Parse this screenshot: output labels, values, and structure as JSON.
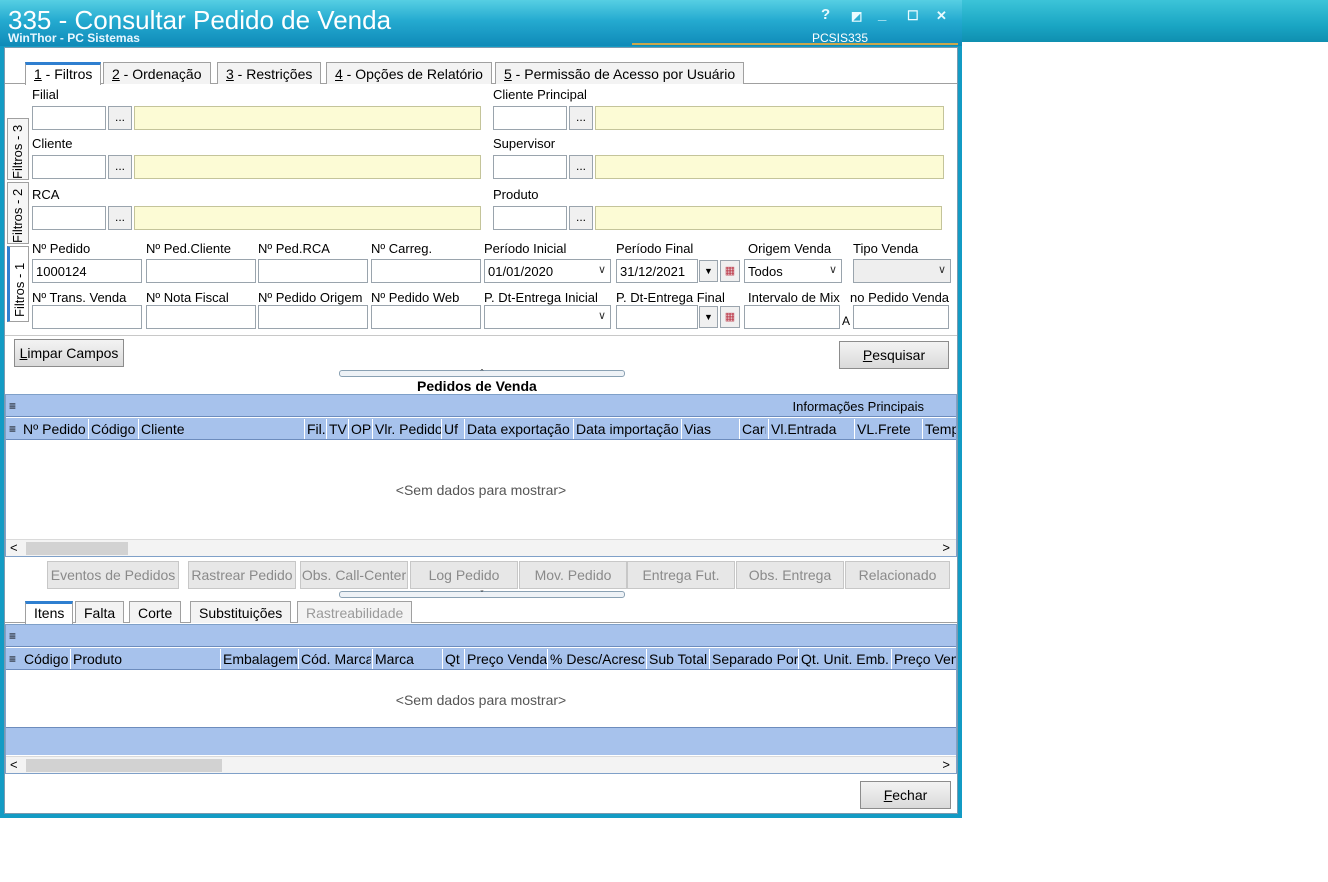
{
  "window": {
    "title": "335 - Consultar Pedido de Venda",
    "subtitle": "WinThor - PC Sistemas",
    "routine_code": "PCSIS335",
    "controls": {
      "help": "?",
      "restore_small": "◩",
      "minimize": "_",
      "maximize": "☐",
      "close": "✕"
    }
  },
  "tabs": [
    {
      "num": "1",
      "label": " - Filtros"
    },
    {
      "num": "2",
      "label": " - Ordenação"
    },
    {
      "num": "3",
      "label": " - Restrições"
    },
    {
      "num": "4",
      "label": " - Opções de Relatório"
    },
    {
      "num": "5",
      "label": " - Permissão de Acesso por Usuário"
    }
  ],
  "vertical_tabs": [
    "Filtros - 3",
    "Filtros - 2",
    "Filtros - 1"
  ],
  "filters": {
    "filial": "Filial",
    "cliente_principal": "Cliente Principal",
    "cliente": "Cliente",
    "supervisor": "Supervisor",
    "rca": "RCA",
    "produto": "Produto",
    "lookup_button": "..."
  },
  "fields_row1": {
    "num_pedido": {
      "label": "Nº Pedido",
      "value": "1000124"
    },
    "num_ped_cliente": {
      "label": "Nº Ped.Cliente",
      "value": ""
    },
    "num_ped_rca": {
      "label": "Nº Ped.RCA",
      "value": ""
    },
    "num_carreg": {
      "label": "Nº Carreg.",
      "value": ""
    },
    "periodo_inicial": {
      "label": "Período Inicial",
      "value": "01/01/2020"
    },
    "periodo_final": {
      "label": "Período Final",
      "value": "31/12/2021"
    },
    "origem_venda": {
      "label": "Origem Venda",
      "value": "Todos"
    },
    "tipo_venda": {
      "label": "Tipo Venda",
      "value": ""
    }
  },
  "fields_row2": {
    "num_trans_venda": {
      "label": "Nº Trans. Venda"
    },
    "num_nota_fiscal": {
      "label": "Nº Nota Fiscal"
    },
    "num_pedido_origem": {
      "label": "Nº Pedido Origem"
    },
    "num_pedido_web": {
      "label": "Nº Pedido Web"
    },
    "p_dt_entrega_inicial": {
      "label": "P. Dt-Entrega Inicial"
    },
    "p_dt_entrega_final": {
      "label": "P. Dt-Entrega Final"
    },
    "intervalo_mix": {
      "label": "Intervalo de Mix",
      "a": "A"
    },
    "no_pedido_venda": {
      "label": "no Pedido Venda"
    }
  },
  "buttons": {
    "limpar_campos_u": "L",
    "limpar_campos": "impar Campos",
    "pesquisar_u": "P",
    "pesquisar": "esquisar",
    "fechar_u": "F",
    "fechar": "echar"
  },
  "pedidos": {
    "title": "Pedidos de  Venda",
    "band": "Informações Principais",
    "columns": [
      "Nº Pedido",
      "Código",
      "Cliente",
      "Fil.",
      "TV",
      "OP",
      "Vlr. Pedido",
      "Uf",
      "Data exportação",
      "Data importação",
      "Vias",
      "Carı",
      "Vl.Entrada",
      "VL.Frete",
      "Temp"
    ],
    "empty": "<Sem dados para mostrar>"
  },
  "action_buttons": [
    "Eventos de Pedidos",
    "Rastrear Pedido",
    "Obs. Call-Center",
    "Log Pedido",
    "Mov. Pedido",
    "Entrega Fut.",
    "Obs. Entrega",
    "Relacionado"
  ],
  "bottom_tabs": [
    "Itens",
    "Falta",
    "Corte",
    "Substituições",
    "Rastreabilidade"
  ],
  "itens": {
    "columns": [
      "Código",
      "Produto",
      "Embalagem",
      "Cód. Marca",
      "Marca",
      "Qt",
      "Preço Venda",
      "% Desc/Acresc",
      "Sub Total",
      "Separado Por",
      "Qt. Unit. Emb.",
      "Preço Ven"
    ],
    "empty": "<Sem dados para mostrar>"
  },
  "colors": {
    "title_bar": "#139bc4",
    "grid_header": "#a7c2ec",
    "lookup_yellow": "#fcfbd5",
    "active_tab": "#2f7fd0"
  }
}
